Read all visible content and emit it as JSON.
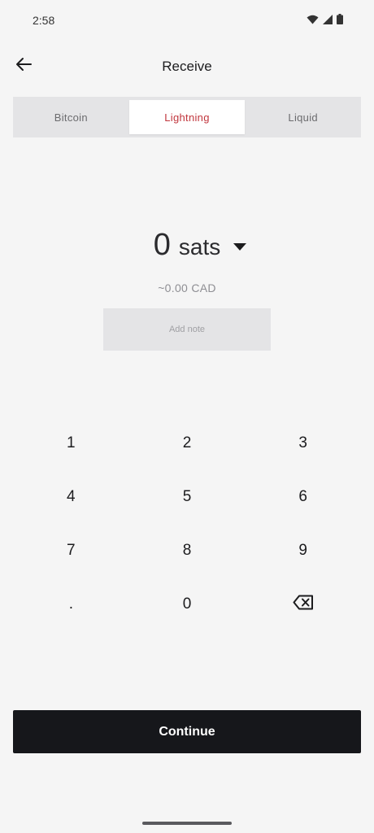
{
  "status_bar": {
    "time": "2:58"
  },
  "header": {
    "title": "Receive"
  },
  "tabs": [
    {
      "label": "Bitcoin",
      "active": false
    },
    {
      "label": "Lightning",
      "active": true
    },
    {
      "label": "Liquid",
      "active": false
    }
  ],
  "amount": {
    "value": "0",
    "unit": "sats",
    "fiat": "~0.00 CAD"
  },
  "note": {
    "label": "Add note"
  },
  "keypad": {
    "keys": [
      "1",
      "2",
      "3",
      "4",
      "5",
      "6",
      "7",
      "8",
      "9",
      ".",
      "0"
    ]
  },
  "continue": {
    "label": "Continue"
  },
  "colors": {
    "accent": "#c1363d",
    "button_bg": "#16171b",
    "background": "#f5f5f5"
  },
  "icons": {
    "back": "arrow-left-icon",
    "dropdown": "caret-down-icon",
    "backspace": "backspace-icon",
    "wifi": "wifi-icon",
    "signal": "signal-icon",
    "battery": "battery-icon"
  }
}
